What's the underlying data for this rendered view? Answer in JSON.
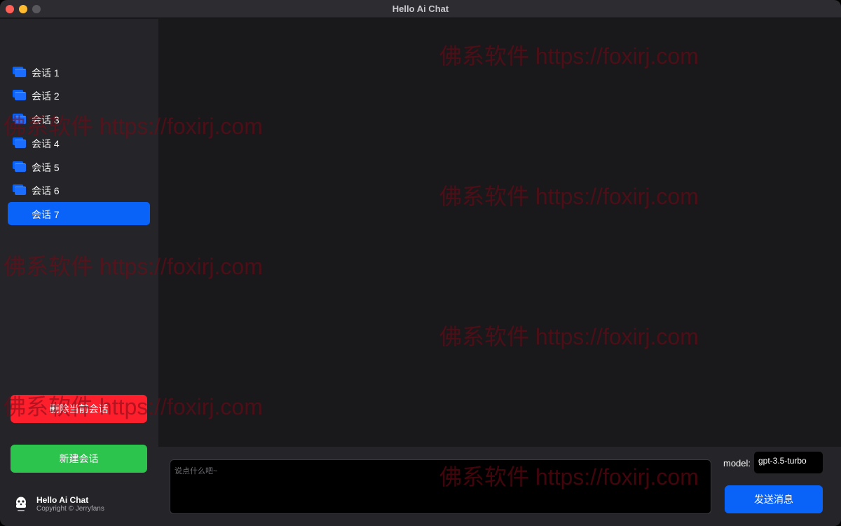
{
  "window": {
    "title": "Hello Ai Chat"
  },
  "sidebar": {
    "sessions": [
      {
        "label": "会话 1",
        "active": false
      },
      {
        "label": "会话 2",
        "active": false
      },
      {
        "label": "会话 3",
        "active": false
      },
      {
        "label": "会话 4",
        "active": false
      },
      {
        "label": "会话 5",
        "active": false
      },
      {
        "label": "会话 6",
        "active": false
      },
      {
        "label": "会话 7",
        "active": true
      }
    ],
    "delete_label": "删除当前会话",
    "new_label": "新建会话",
    "footer": {
      "app_name": "Hello Ai Chat",
      "copyright": "Copyright © Jerryfans"
    }
  },
  "composer": {
    "placeholder": "说点什么吧~",
    "value": "",
    "model_label": "model:",
    "model_value": "gpt-3.5-turbo",
    "send_label": "发送消息"
  },
  "watermark": {
    "text": "佛系软件 https://foxirj.com"
  },
  "colors": {
    "accent": "#0a63f8",
    "danger": "#fe1f2d",
    "success": "#2dc44e",
    "sidebar_bg": "#252428",
    "main_bg": "#19181b"
  }
}
